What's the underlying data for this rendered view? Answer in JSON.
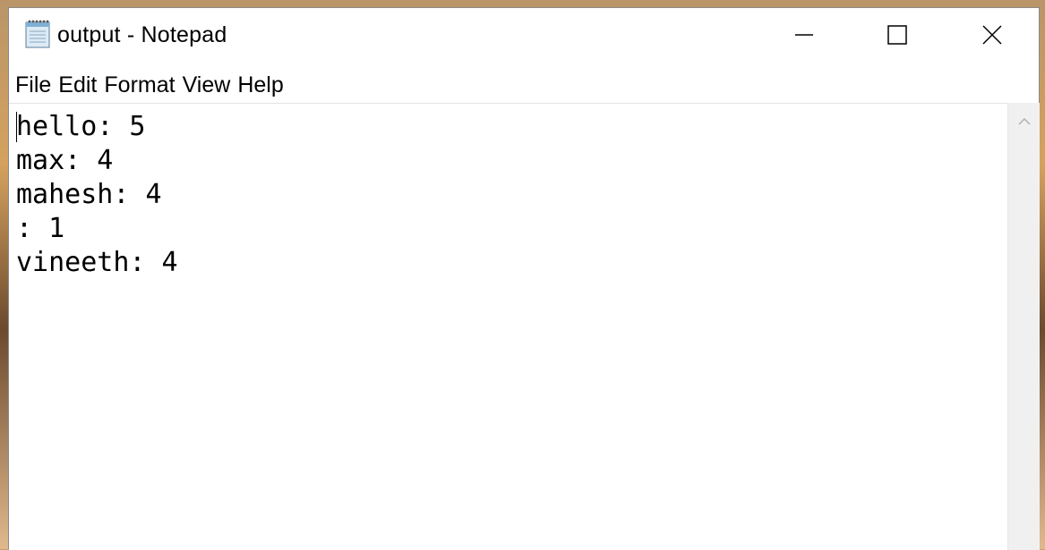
{
  "window": {
    "title": "output - Notepad"
  },
  "titlebar": {
    "app_icon": "notepad-icon",
    "minimize_icon": "minimize-icon",
    "maximize_icon": "maximize-icon",
    "close_icon": "close-icon"
  },
  "menu": {
    "items": [
      {
        "label": "File"
      },
      {
        "label": "Edit"
      },
      {
        "label": "Format"
      },
      {
        "label": "View"
      },
      {
        "label": "Help"
      }
    ]
  },
  "editor": {
    "lines": [
      "hello: 5",
      "max: 4",
      "mahesh: 4",
      ": 1",
      "vineeth: 4"
    ]
  },
  "scrollbar": {
    "up_icon": "chevron-up-icon"
  },
  "colors": {
    "window_bg": "#ffffff",
    "scrollbar_bg": "#f0f0f0",
    "text": "#000000"
  }
}
